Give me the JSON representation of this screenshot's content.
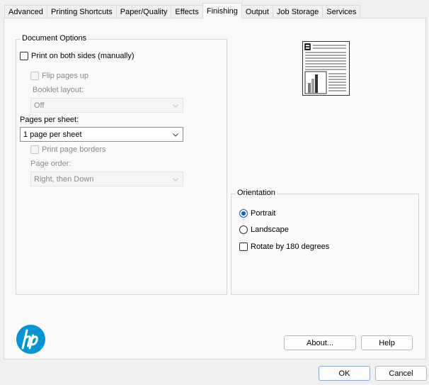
{
  "tabs": [
    {
      "label": "Advanced",
      "active": false
    },
    {
      "label": "Printing Shortcuts",
      "active": false
    },
    {
      "label": "Paper/Quality",
      "active": false
    },
    {
      "label": "Effects",
      "active": false
    },
    {
      "label": "Finishing",
      "active": true
    },
    {
      "label": "Output",
      "active": false
    },
    {
      "label": "Job Storage",
      "active": false
    },
    {
      "label": "Services",
      "active": false
    }
  ],
  "document_options": {
    "title": "Document Options",
    "print_both_sides": {
      "label": "Print on both sides (manually)",
      "checked": false
    },
    "flip_pages_up": {
      "label": "Flip pages up",
      "checked": false
    },
    "booklet_layout": {
      "label": "Booklet layout:",
      "value": "Off"
    },
    "pages_per_sheet": {
      "label": "Pages per sheet:",
      "value": "1 page per sheet"
    },
    "print_page_borders": {
      "label": "Print page borders",
      "checked": false
    },
    "page_order": {
      "label": "Page order:",
      "value": "Right, then Down"
    }
  },
  "orientation": {
    "title": "Orientation",
    "portrait": {
      "label": "Portrait",
      "selected": true
    },
    "landscape": {
      "label": "Landscape",
      "selected": false
    },
    "rotate": {
      "label": "Rotate by 180 degrees",
      "checked": false
    }
  },
  "buttons": {
    "about": "About...",
    "help": "Help",
    "ok": "OK",
    "cancel": "Cancel"
  },
  "logo": {
    "text": "hp",
    "color": "#0096d6"
  },
  "colors": {
    "accent": "#0f5fc6",
    "brand": "#0096d6"
  }
}
